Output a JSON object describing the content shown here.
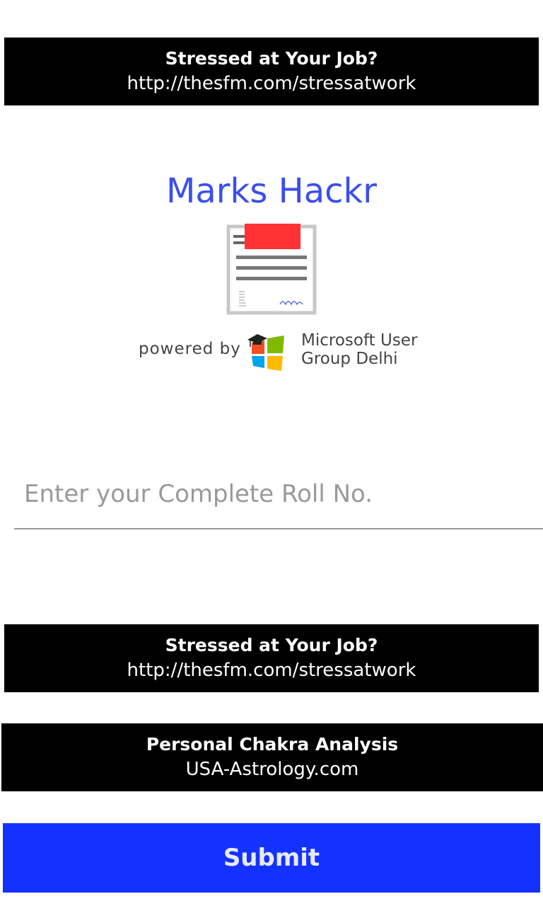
{
  "ads": {
    "top": {
      "title": "Stressed at Your Job?",
      "url": "http://thesfm.com/stressatwork"
    },
    "middle": {
      "title": "Stressed at Your Job?",
      "url": "http://thesfm.com/stressatwork"
    },
    "bottom": {
      "title": "Personal Chakra Analysis",
      "url": "USA-Astrology.com"
    }
  },
  "app": {
    "title": "Marks Hackr",
    "powered_by": "powered by",
    "org_line1": "Microsoft User",
    "org_line2": "Group Delhi",
    "icon": "report-card-icon",
    "org_logo": "windows-graduation-cap-logo"
  },
  "form": {
    "roll_placeholder": "Enter your Complete Roll No.",
    "roll_value": "",
    "submit_label": "Submit"
  },
  "colors": {
    "title": "#3b4ef0",
    "submit_bg": "#1432ff",
    "ad_bg": "#000000",
    "accent_red": "#ff3333"
  }
}
